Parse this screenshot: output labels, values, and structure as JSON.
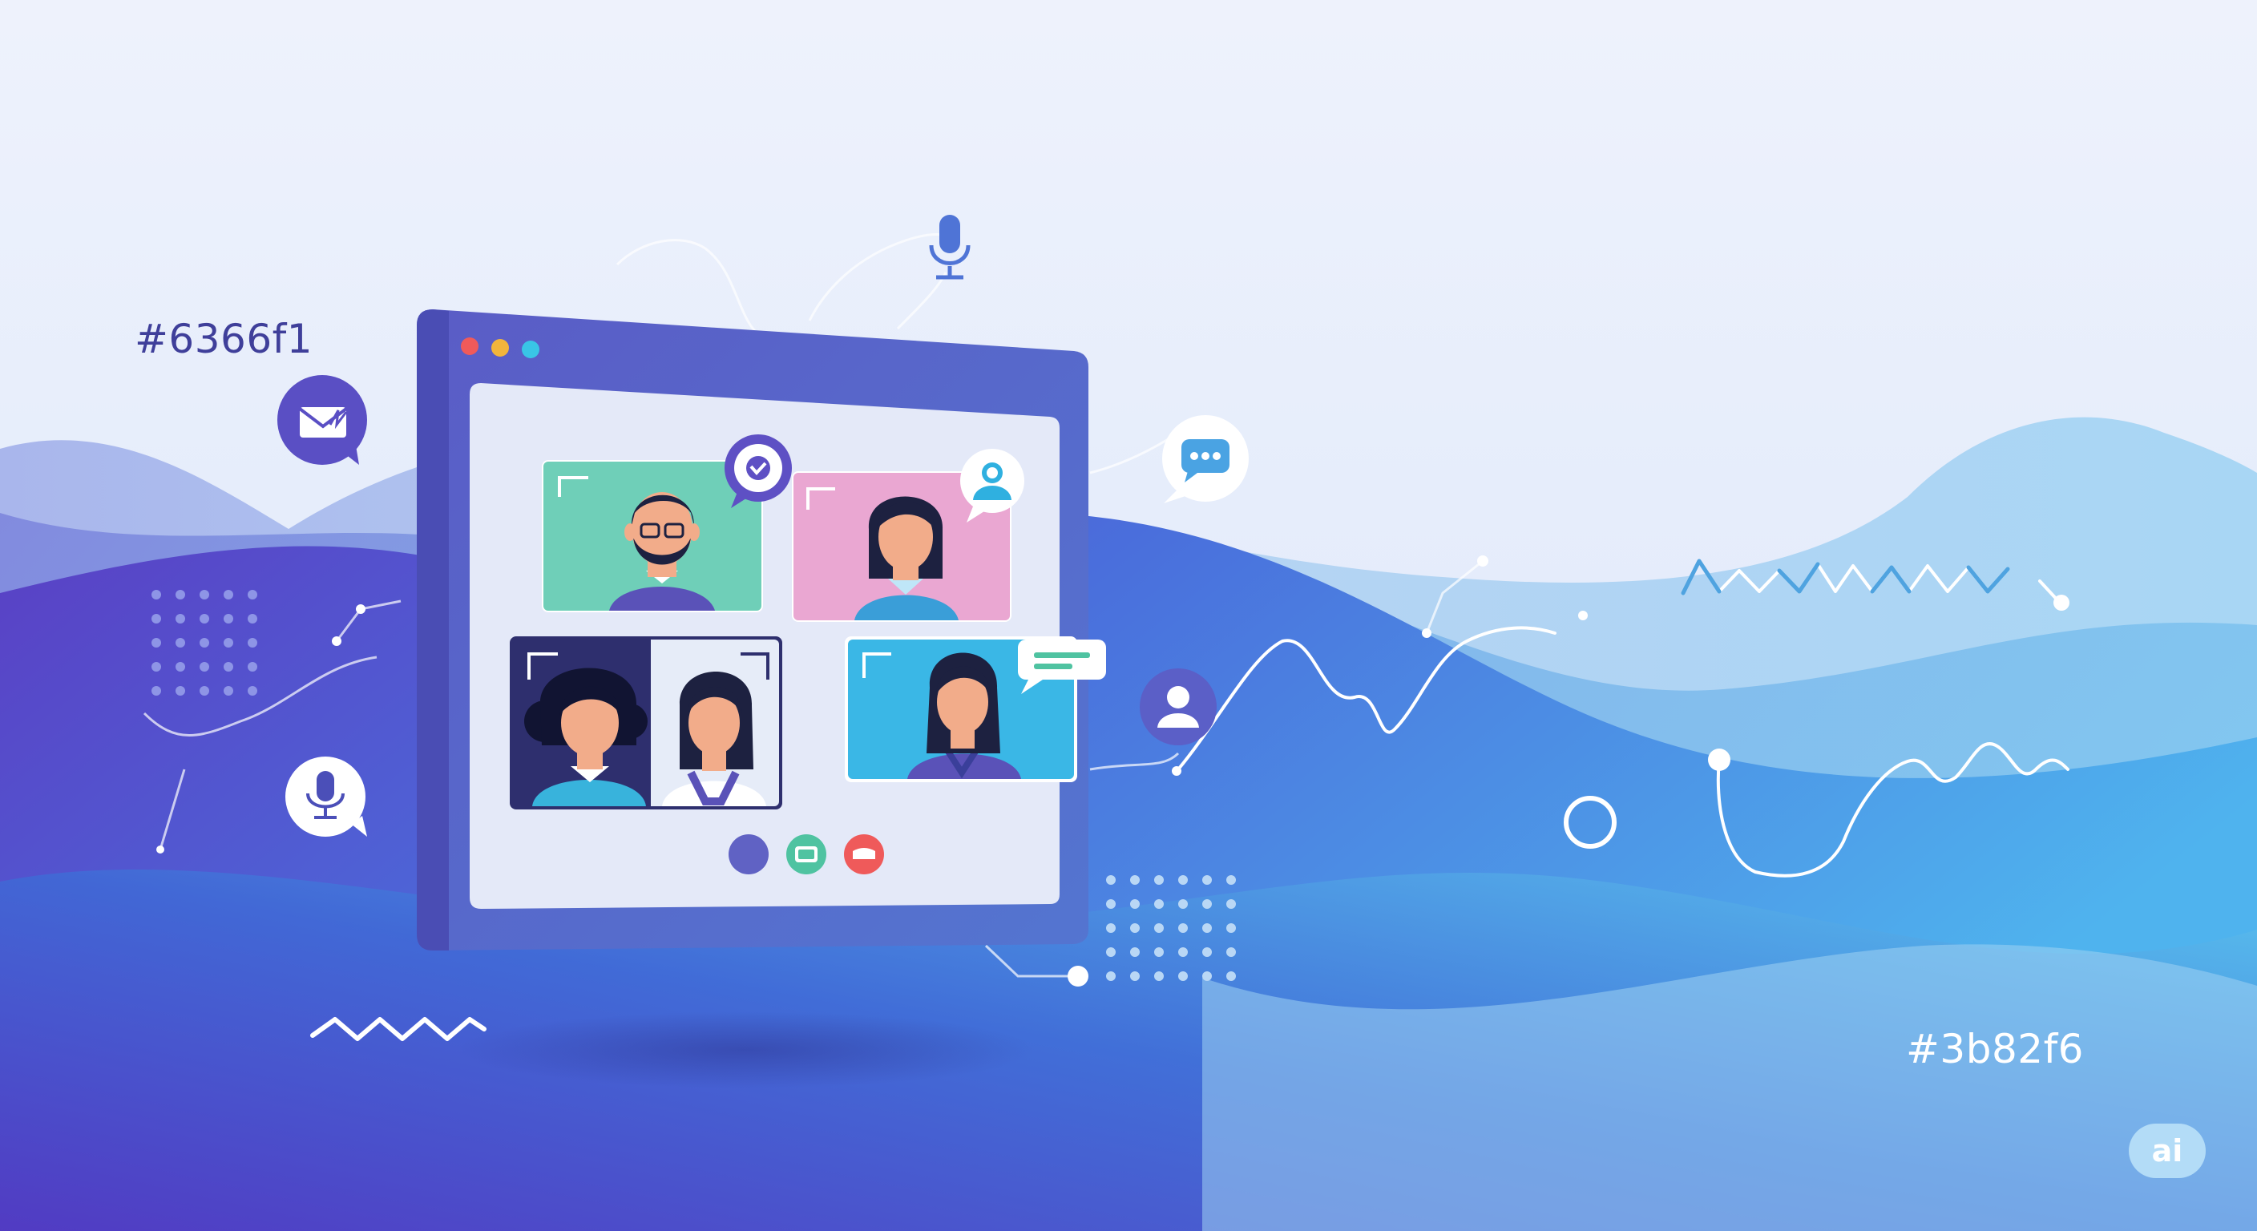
{
  "labels": {
    "color_primary_hex": "#6366f1",
    "color_secondary_hex": "#3b82f6",
    "badge": "ai"
  },
  "palette": {
    "indigo": "#6366f1",
    "blue": "#3b82f6",
    "window_frame": "#5b5fc7",
    "window_screen": "#e4e9f8",
    "tile_teal": "#6fcfb8",
    "tile_pink": "#eaa7d2",
    "tile_navy": "#2e2f6e",
    "tile_cyan": "#3ab7e6",
    "control_join": "#6062c4",
    "control_video": "#4fc3a1",
    "control_leave": "#ef5a5a",
    "traffic_red": "#f05a5a",
    "traffic_yellow": "#f2b53c",
    "traffic_cyan": "#39c5e6"
  },
  "icons": [
    "envelope-icon",
    "microphone-icon",
    "chat-bubble-icon",
    "user-icon",
    "chat-dots-icon",
    "check-badge-icon",
    "camera-icon",
    "hangup-icon"
  ]
}
